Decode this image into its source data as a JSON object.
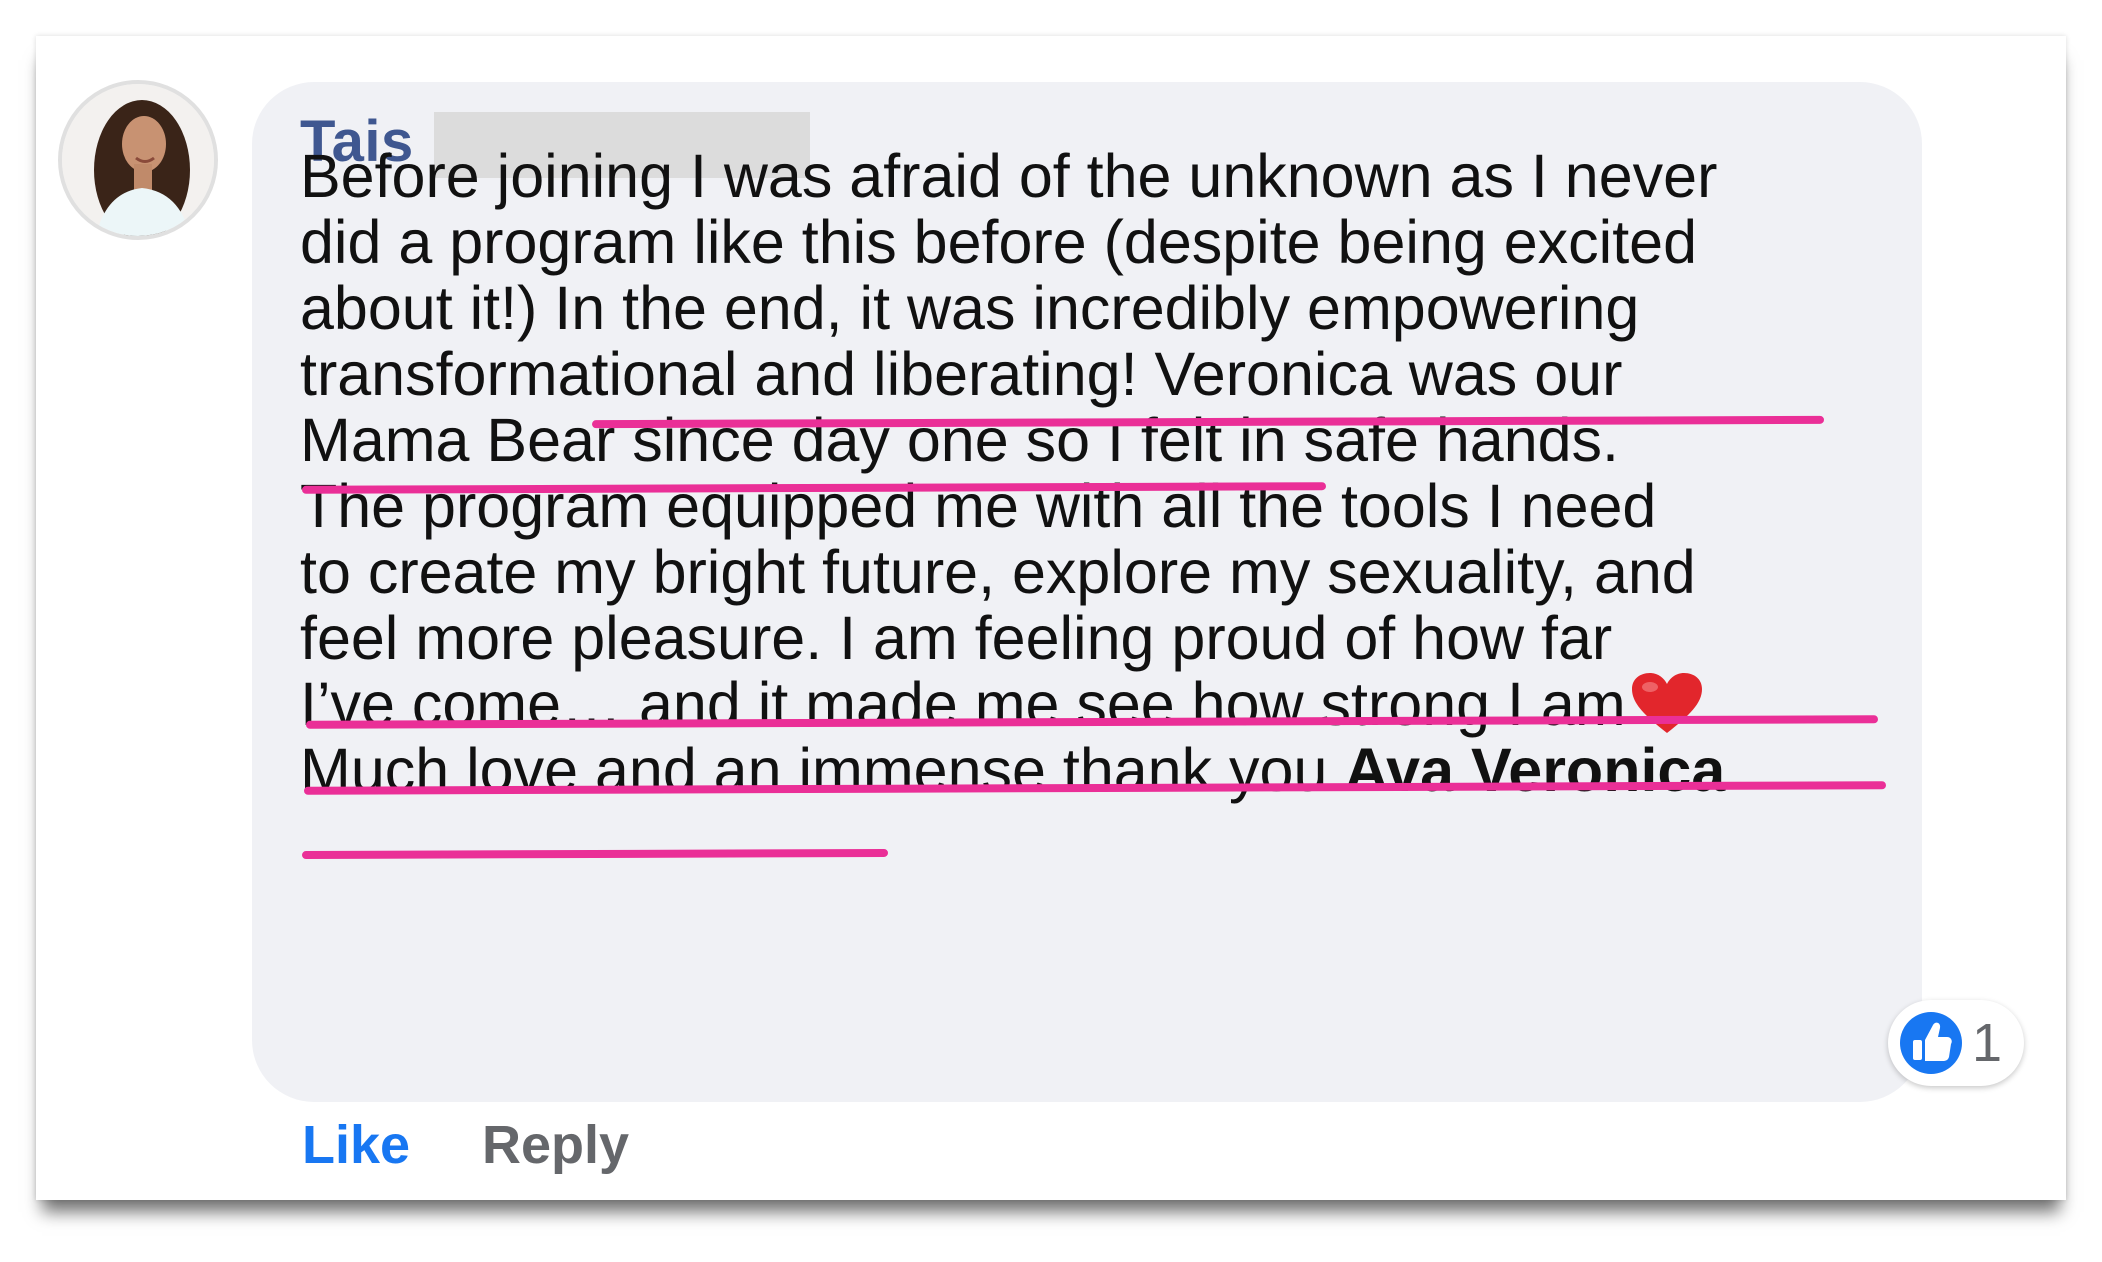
{
  "comment": {
    "author_name": "Tais",
    "lines": [
      "Before joining I was afraid of the unknown as I never",
      "did a program like this before (despite being excited",
      "about it!) In the end, it was incredibly empowering",
      "transformational and liberating! Veronica was our",
      "Mama Bear since day one so I felt in safe hands.",
      "The program equipped me with all the tools I need",
      "to create my bright future, explore my sexuality, and",
      "feel more pleasure. I am feeling proud of how far",
      "I’ve come… and it made me see how strong I am"
    ],
    "last_line_prefix": "Much love and an immense thank you ",
    "mention": "Ava Veronica",
    "underline_color": "#ea2f97"
  },
  "reactions": {
    "icon": "like-thumbs-up-icon",
    "count": "1",
    "color": "#1877f2"
  },
  "actions": {
    "like_label": "Like",
    "reply_label": "Reply"
  }
}
